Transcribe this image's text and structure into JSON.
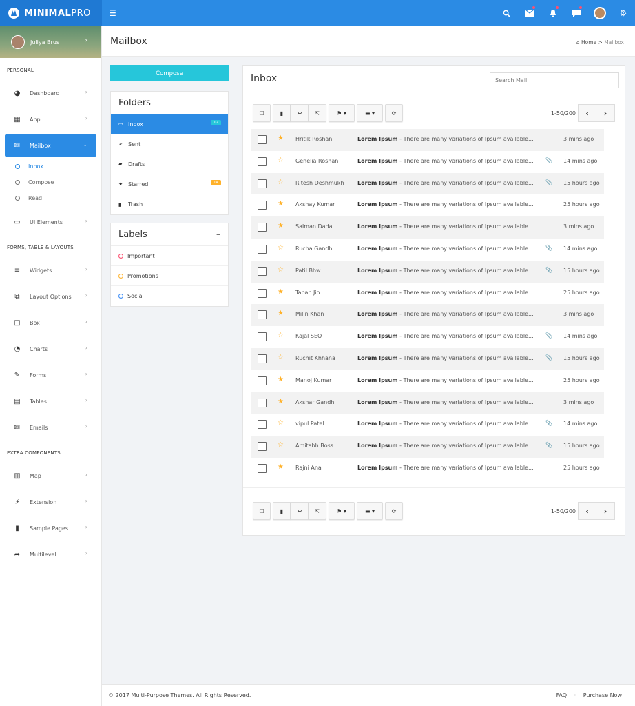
{
  "brand": {
    "name_bold": "MINIMAL",
    "name_light": "PRO"
  },
  "topbar": {
    "icons": [
      "search-icon",
      "mail-icon",
      "bell-icon",
      "chat-icon",
      "avatar",
      "gear-icon"
    ]
  },
  "user": {
    "name": "Juliya Brus"
  },
  "sidebar": {
    "sections": {
      "personal": "PERSONAL",
      "forms": "FORMS, TABLE & LAYOUTS",
      "extra": "EXTRA COMPONENTS"
    },
    "items": {
      "dashboard": "Dashboard",
      "app": "App",
      "mailbox": "Mailbox",
      "ui_elements": "UI Elements",
      "widgets": "Widgets",
      "layout_options": "Layout Options",
      "box": "Box",
      "charts": "Charts",
      "forms": "Forms",
      "tables": "Tables",
      "emails": "Emails",
      "map": "Map",
      "extension": "Extension",
      "sample_pages": "Sample Pages",
      "multilevel": "Multilevel"
    },
    "mailbox_sub": {
      "inbox": "Inbox",
      "compose": "Compose",
      "read": "Read"
    }
  },
  "header": {
    "title": "Mailbox",
    "breadcrumb_home": "Home",
    "breadcrumb_sep": ">",
    "breadcrumb_current": "Mailbox"
  },
  "compose_label": "Compose",
  "folders": {
    "title": "Folders",
    "items": [
      {
        "label": "Inbox",
        "badge": "12"
      },
      {
        "label": "Sent"
      },
      {
        "label": "Drafts"
      },
      {
        "label": "Starred",
        "badge": "14"
      },
      {
        "label": "Trash"
      }
    ]
  },
  "labels": {
    "title": "Labels",
    "items": [
      {
        "label": "Important",
        "color": "#fc4b6c"
      },
      {
        "label": "Promotions",
        "color": "#ffb22b"
      },
      {
        "label": "Social",
        "color": "#398bf7"
      }
    ]
  },
  "inbox": {
    "title": "Inbox",
    "search_placeholder": "Search Mail",
    "pagination": "1-50/200",
    "subject": "Lorem Ipsum",
    "snippet": " - There are many variations of Ipsum available...",
    "emails": [
      {
        "from": "Hritik Roshan",
        "starred": true,
        "attach": false,
        "time": "3 mins ago"
      },
      {
        "from": "Genelia Roshan",
        "starred": false,
        "attach": true,
        "time": "14 mins ago"
      },
      {
        "from": "Ritesh Deshmukh",
        "starred": false,
        "attach": true,
        "time": "15 hours ago"
      },
      {
        "from": "Akshay Kumar",
        "starred": true,
        "attach": false,
        "time": "25 hours ago"
      },
      {
        "from": "Salman Dada",
        "starred": true,
        "attach": false,
        "time": "3 mins ago"
      },
      {
        "from": "Rucha Gandhi",
        "starred": false,
        "attach": true,
        "time": "14 mins ago"
      },
      {
        "from": "Patil Bhw",
        "starred": false,
        "attach": true,
        "time": "15 hours ago"
      },
      {
        "from": "Tapan Jio",
        "starred": true,
        "attach": false,
        "time": "25 hours ago"
      },
      {
        "from": "Milin Khan",
        "starred": true,
        "attach": false,
        "time": "3 mins ago"
      },
      {
        "from": "Kajal SEO",
        "starred": false,
        "attach": true,
        "time": "14 mins ago"
      },
      {
        "from": "Ruchit Khhana",
        "starred": false,
        "attach": true,
        "time": "15 hours ago"
      },
      {
        "from": "Manoj Kumar",
        "starred": true,
        "attach": false,
        "time": "25 hours ago"
      },
      {
        "from": "Akshar Gandhi",
        "starred": true,
        "attach": false,
        "time": "3 mins ago"
      },
      {
        "from": "vipul Patel",
        "starred": false,
        "attach": true,
        "time": "14 mins ago"
      },
      {
        "from": "Amitabh Boss",
        "starred": false,
        "attach": true,
        "time": "15 hours ago"
      },
      {
        "from": "Rajni Ana",
        "starred": true,
        "attach": false,
        "time": "25 hours ago"
      }
    ]
  },
  "footer": {
    "copyright": "© 2017 Multi-Purpose Themes. All Rights Reserved.",
    "faq": "FAQ",
    "sep": "·",
    "purchase": "Purchase Now"
  }
}
